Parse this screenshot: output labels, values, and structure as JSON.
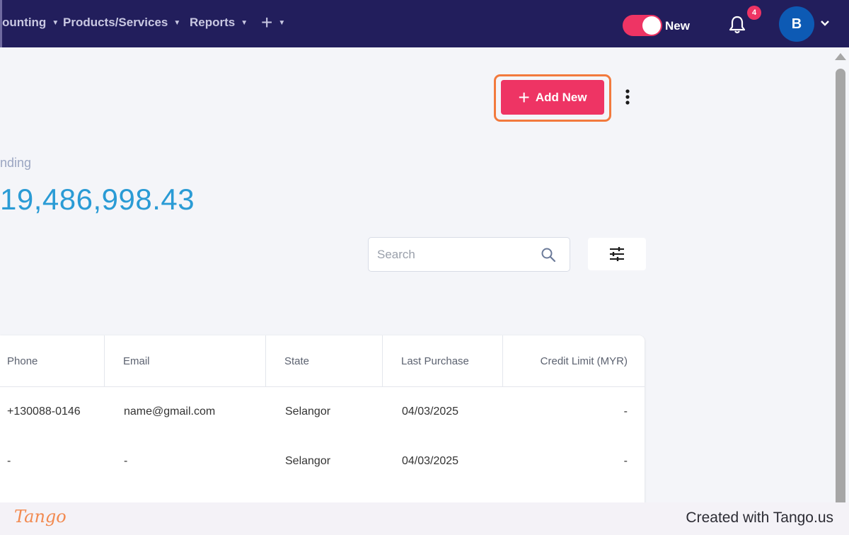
{
  "nav": {
    "items": [
      {
        "label": "ounting"
      },
      {
        "label": "Products/Services"
      },
      {
        "label": "Reports"
      }
    ],
    "toggle_label": "New",
    "notification_count": "4",
    "avatar_initial": "B"
  },
  "toolbar": {
    "add_new_label": "Add New"
  },
  "summary": {
    "outstanding_label": "nding",
    "outstanding_value": "19,486,998.43"
  },
  "search": {
    "placeholder": "Search"
  },
  "table": {
    "columns": [
      "Phone",
      "Email",
      "State",
      "Last Purchase",
      "Credit Limit (MYR)"
    ],
    "rows": [
      {
        "phone": "+130088-0146",
        "email": "name@gmail.com",
        "state": "Selangor",
        "last_purchase": "04/03/2025",
        "credit_limit": "-"
      },
      {
        "phone": "-",
        "email": "-",
        "state": "Selangor",
        "last_purchase": "04/03/2025",
        "credit_limit": "-"
      }
    ]
  },
  "footer": {
    "logo_text": "Tango",
    "credit_text": "Created with Tango.us"
  },
  "colors": {
    "nav_bg": "#221e5c",
    "accent": "#ee3464",
    "highlight": "#f27a3d",
    "amount": "#2a9bd5"
  }
}
